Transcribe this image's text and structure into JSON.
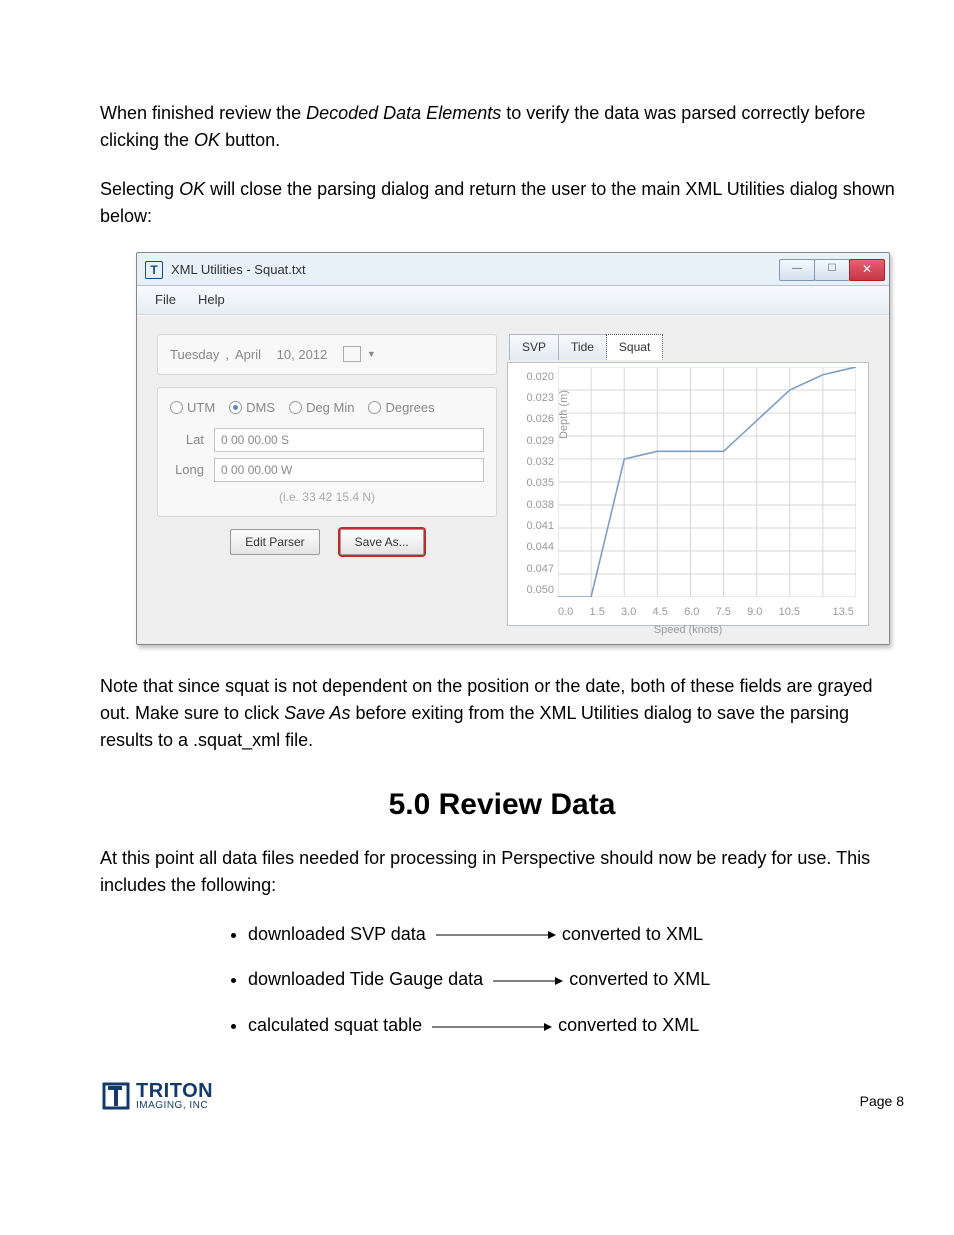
{
  "para1": {
    "t1": "When finished review the ",
    "em1": "Decoded Data Elements",
    "t2": " to verify the data was parsed correctly before clicking the ",
    "em2": "OK",
    "t3": " button."
  },
  "para2": {
    "t1": "Selecting ",
    "em1": "OK",
    "t2": " will close the parsing dialog and return the user to the main XML Utilities dialog shown below:"
  },
  "window": {
    "title": "XML Utilities - Squat.txt",
    "menu": [
      "File",
      "Help"
    ],
    "date": {
      "weekday": "Tuesday",
      "sep": ",",
      "month": "April",
      "day_year": "10, 2012"
    },
    "coord": {
      "radios": [
        "UTM",
        "DMS",
        "Deg Min",
        "Degrees"
      ],
      "selected": "DMS",
      "lat_label": "Lat",
      "lat_value": "0 00 00.00 S",
      "long_label": "Long",
      "long_value": "0 00 00.00 W",
      "hint": "(i.e. 33 42 15.4 N)"
    },
    "buttons": {
      "edit": "Edit Parser",
      "save": "Save As..."
    },
    "tabs": [
      "SVP",
      "Tide",
      "Squat"
    ],
    "active_tab": "Squat",
    "yticks": [
      "0.020",
      "0.023",
      "0.026",
      "0.029",
      "0.032",
      "0.035",
      "0.038",
      "0.041",
      "0.044",
      "0.047",
      "0.050"
    ],
    "xticks": [
      "0.0",
      "1.5",
      "3.0",
      "4.5",
      "6.0",
      "7.5",
      "9.0",
      "10.5",
      "",
      "13.5"
    ],
    "xlabel": "Speed (knots)",
    "ylabel": "Depth (m)"
  },
  "para3": {
    "t1": "Note that since squat is not dependent on the position or the date, both of these fields are grayed out.  Make sure to click ",
    "em1": "Save As",
    "t2": " before exiting from the XML Utilities dialog to save the parsing results to a .squat_xml file."
  },
  "section_heading": "5.0 Review Data",
  "para4": "At this point all data files needed for processing in Perspective should now be ready for use.  This includes the following:",
  "bullets": [
    {
      "left": "downloaded SVP data",
      "right": "converted to XML",
      "aw": 120
    },
    {
      "left": "downloaded Tide Gauge data",
      "right": "converted to XML",
      "aw": 70
    },
    {
      "left": "calculated squat table",
      "right": "converted to XML",
      "aw": 120
    }
  ],
  "logo": {
    "l1": "TRITON",
    "l2": "IMAGING, INC"
  },
  "page_label": "Page 8",
  "chart_data": {
    "type": "line",
    "title": "",
    "xlabel": "Speed (knots)",
    "ylabel": "Depth (m)",
    "xlim": [
      0.0,
      13.5
    ],
    "ylim": [
      0.05,
      0.02
    ],
    "x": [
      0.0,
      1.5,
      3.0,
      4.5,
      6.0,
      7.5,
      9.0,
      10.5,
      12.0,
      13.5
    ],
    "depth": [
      0.05,
      0.05,
      0.032,
      0.031,
      0.031,
      0.031,
      0.027,
      0.023,
      0.021,
      0.02
    ]
  }
}
